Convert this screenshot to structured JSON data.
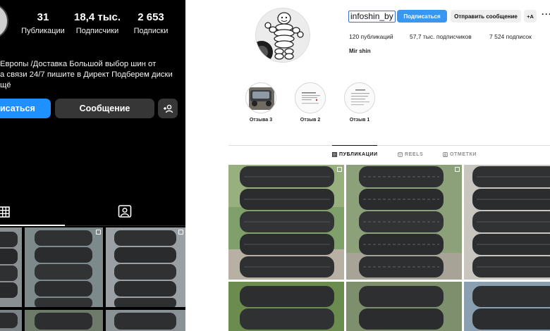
{
  "mobile": {
    "stats": [
      {
        "value": "31",
        "label": "Публикации"
      },
      {
        "value": "18,4 тыс.",
        "label": "Подписчики"
      },
      {
        "value": "2 653",
        "label": "Подписки"
      }
    ],
    "bio_lines": [
      "Европы /Доставка  Большой выбор шин от",
      "а связи 24/7 пишите в Директ Подберем диски",
      "щё"
    ],
    "follow_label": "исаться",
    "message_label": "Сообщение",
    "add_icon": "person-add-icon",
    "tabs": [
      "grid-icon",
      "tagged-icon"
    ]
  },
  "desktop": {
    "username": "infoshin_by",
    "follow_label": "Подписаться",
    "message_label": "Отправить сообщение",
    "add_label": "+A",
    "more_label": "···",
    "stats": {
      "posts": "120 публикаций",
      "followers": "57,7 тыс. подписчиков",
      "following": "7 524 подписок"
    },
    "display_name": "Mir shin",
    "highlights": [
      {
        "label": "Отзыва 3"
      },
      {
        "label": "Отзыв 2"
      },
      {
        "label": "Отзыв 1"
      }
    ],
    "tabs": [
      {
        "label": "ПУБЛИКАЦИИ",
        "icon": "grid-icon",
        "active": true
      },
      {
        "label": "REELS",
        "icon": "reels-icon",
        "active": false
      },
      {
        "label": "ОТМЕТКИ",
        "icon": "tag-icon",
        "active": false
      }
    ]
  },
  "colors": {
    "follow_blue": "#1e90ff",
    "desk_follow_blue": "#3897f0",
    "dark_button": "#363636"
  }
}
